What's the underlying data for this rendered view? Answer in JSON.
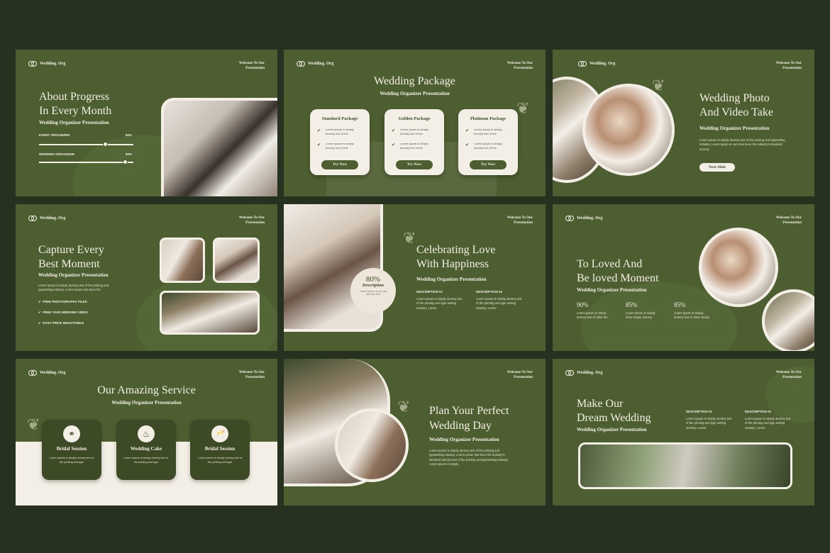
{
  "common": {
    "logo": "Wedding. Org",
    "welcome": "Welcome To Our Presentation",
    "subtitle": "Wedding Organizer Presentation",
    "lorem": "Lorem Ipsum is simply dummy text of the printing and typesetting industry. Lorem Ipsum has been the",
    "lorem_short": "Lorem Ipsum is simply dummy text of the printing and type",
    "lorem_card": "Lorem Ipsum is simply dummy text of the",
    "lorem_desc": "Lorem Ipsum is simply dummy text of the printing and type setting industry. Lorem"
  },
  "s1": {
    "title_1": "About Progress",
    "title_2": "In Every Month",
    "rows": [
      {
        "label": "EVENT ORGANIZER",
        "pct": "80%",
        "value": 0.8
      },
      {
        "label": "WEDDING ORGANIZER",
        "pct": "90%",
        "value": 0.9
      }
    ]
  },
  "s2": {
    "title": "Wedding Package",
    "cards": [
      {
        "name": "Standard Package",
        "button": "Try Now"
      },
      {
        "name": "Golden Package",
        "button": "Try Now"
      },
      {
        "name": "Platinum Package",
        "button": "Try Now"
      }
    ]
  },
  "s3": {
    "title_1": "Wedding Photo",
    "title_2": "And Video Take",
    "body": "Lorem Ipsum is simply dummy text of the printing and typesetting industry. Lorem ipsum at vero has been the industry's standard dummy",
    "button": "Next Slide"
  },
  "s4": {
    "title_1": "Capture Every",
    "title_2": "Best Moment",
    "body": "Lorem Ipsum is simply dummy text of the printing and typesetting industry. Lorem Ipsum has been the",
    "checks": [
      "FREE PHOTOGRAPHY FILES",
      "FREE TAKE WEDDING VIDEO",
      "EASY PRICE NEGOTIABLE"
    ]
  },
  "s5": {
    "title_1": "Celebrating Love",
    "title_2": "With Happiness",
    "badge_pct": "80%",
    "badge_label": "Description",
    "badge_text": "Lorem ipsum is sim ply dummy text",
    "desc_1": "DESCRIPTION 01",
    "desc_2": "DESCRIPTION 02"
  },
  "s6": {
    "title_1": "To Loved And",
    "title_2": "Be loved Moment",
    "stats": [
      {
        "pct": "90%",
        "text": "Lorem Ipsum is simply dummy text of dolor the"
      },
      {
        "pct": "85%",
        "text": "Lorem Ipsum is simply dolor simply dummy"
      },
      {
        "pct": "85%",
        "text": "Lorem Ipsum is simply dummy text of dolor simply"
      }
    ]
  },
  "s7": {
    "title": "Our Amazing Service",
    "services": [
      {
        "name": "Bridal Session",
        "icon": "rings-icon"
      },
      {
        "name": "Wedding Cake",
        "icon": "cake-icon"
      },
      {
        "name": "Bridal Session",
        "icon": "champagne-icon"
      }
    ]
  },
  "s8": {
    "title_1": "Plan Your Perfect",
    "title_2": "Wedding Day",
    "body": "Lorem Ipsum is simply dummy text of the printing and typesetting industry. Lorem Ipsum has been the industry's standard dummy text of the printing and typesetting industry. Lorem ipsum is simply"
  },
  "s9": {
    "title_1": "Make Our",
    "title_2": "Dream Wedding",
    "desc_1": "DESCRIPTION 01",
    "desc_2": "DESCRIPTION 02"
  },
  "colors": {
    "background": "#27311f",
    "slide": "#4d5f30",
    "cream": "#f4efe6",
    "dark_green": "#3d4a26"
  }
}
